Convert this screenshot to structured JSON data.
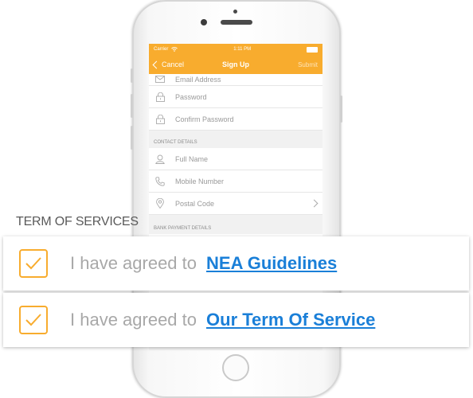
{
  "status_bar": {
    "carrier": "Carrier",
    "time": "1:11 PM"
  },
  "nav": {
    "cancel": "Cancel",
    "title": "Sign Up",
    "submit": "Submit"
  },
  "account_fields": [
    {
      "label": "Email Address",
      "icon": "mail-icon"
    },
    {
      "label": "Password",
      "icon": "lock-icon"
    },
    {
      "label": "Confirm Password",
      "icon": "lock-icon"
    }
  ],
  "contact_section": {
    "header": "CONTACT DETAILS",
    "fields": [
      {
        "label": "Full Name",
        "icon": "user-icon"
      },
      {
        "label": "Mobile Number",
        "icon": "phone-icon"
      },
      {
        "label": "Postal Code",
        "icon": "location-pin-icon"
      }
    ]
  },
  "bank_section": {
    "header": "BANK PAYMENT DETAILS"
  },
  "terms": {
    "heading": "TERM OF SERVICES",
    "items": [
      {
        "text": "I have agreed to",
        "link": "NEA Guidelines",
        "checked": true
      },
      {
        "text": "I have agreed to",
        "link": "Our Term Of Service",
        "checked": true
      }
    ]
  },
  "colors": {
    "accent": "#f8ac2e",
    "link": "#1a7fd8",
    "muted_text": "#a8a8a8"
  }
}
